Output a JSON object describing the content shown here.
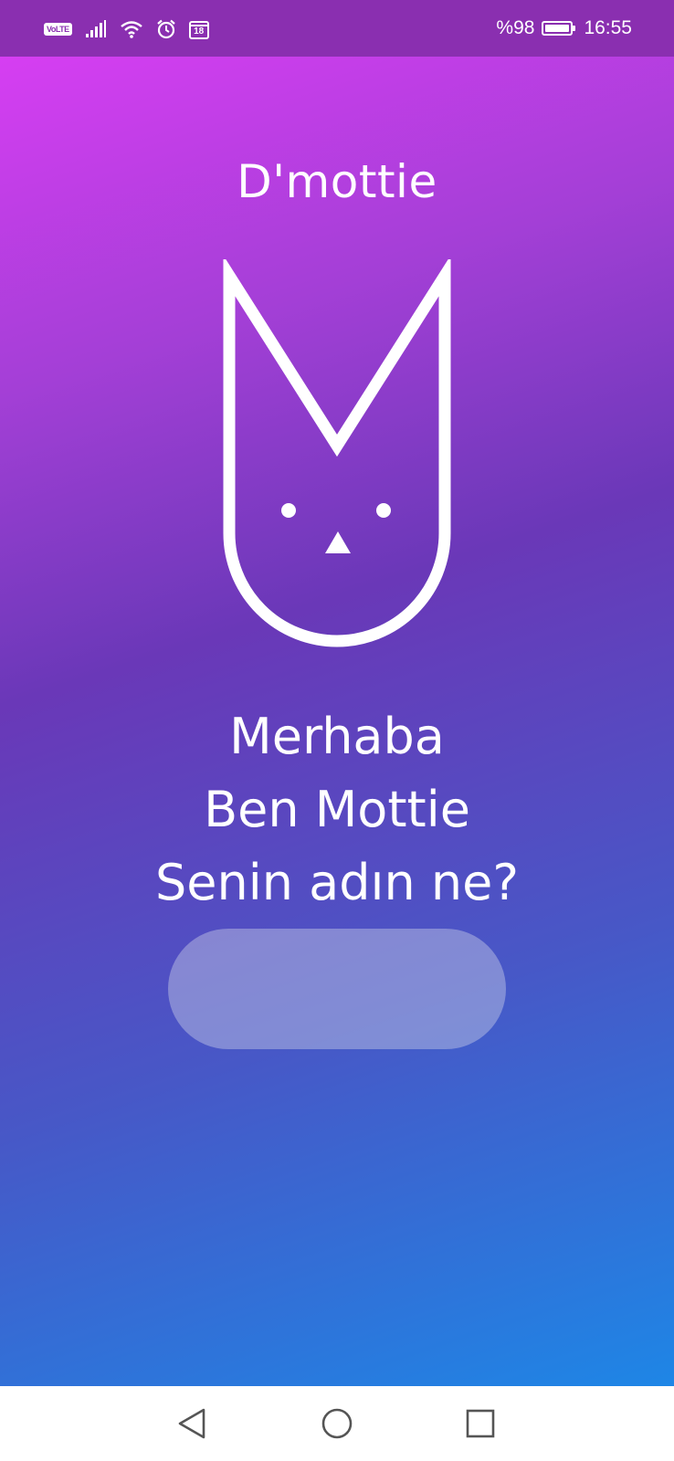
{
  "status_bar": {
    "network_badge": "VoLTE",
    "notification_count": "18",
    "battery": "%98",
    "time": "16:55",
    "icons": [
      "volte-icon",
      "signal-icon",
      "wifi-icon",
      "alarm-icon",
      "calendar-icon",
      "battery-icon"
    ]
  },
  "app": {
    "title": "D'mottie",
    "greeting_lines": [
      "Merhaba",
      "Ben Mottie",
      "Senin adın ne?"
    ],
    "name_input": {
      "value": "",
      "placeholder": ""
    }
  },
  "nav_bar": {
    "buttons": [
      "back-icon",
      "home-icon",
      "recents-icon"
    ]
  },
  "colors": {
    "status_bar": "#8a2fb0",
    "gradient_top": "#d63ef2",
    "gradient_mid": "#6a38b8",
    "gradient_bottom": "#1e86e6",
    "foreground": "#ffffff"
  }
}
